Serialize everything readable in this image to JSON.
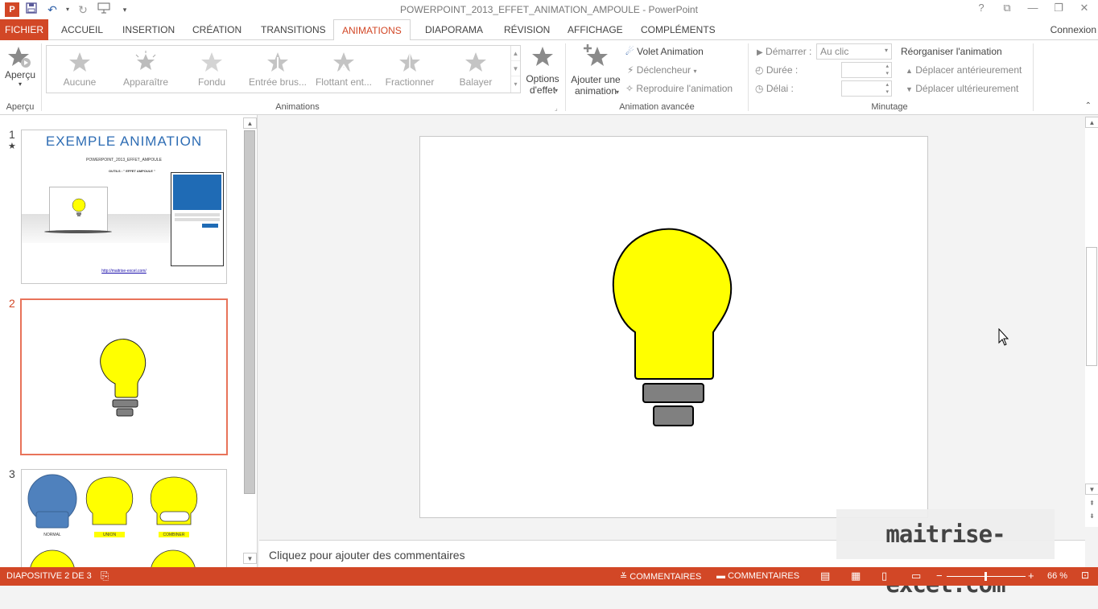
{
  "window": {
    "title": "POWERPOINT_2013_EFFET_ANIMATION_AMPOULE - PowerPoint",
    "app_icon_letter": "P",
    "controls": [
      "?",
      "⧉",
      "—",
      "❐",
      "✕"
    ]
  },
  "tabs": [
    {
      "label": "FICHIER"
    },
    {
      "label": "ACCUEIL"
    },
    {
      "label": "INSERTION"
    },
    {
      "label": "CRÉATION"
    },
    {
      "label": "TRANSITIONS"
    },
    {
      "label": "ANIMATIONS"
    },
    {
      "label": "DIAPORAMA"
    },
    {
      "label": "RÉVISION"
    },
    {
      "label": "AFFICHAGE"
    },
    {
      "label": "COMPLÉMENTS"
    }
  ],
  "connexion_label": "Connexion",
  "ribbon": {
    "preview": {
      "label": "Aperçu",
      "group_label": "Aperçu"
    },
    "gallery": {
      "items": [
        {
          "label": "Aucune"
        },
        {
          "label": "Apparaître"
        },
        {
          "label": "Fondu"
        },
        {
          "label": "Entrée brus..."
        },
        {
          "label": "Flottant ent..."
        },
        {
          "label": "Fractionner"
        },
        {
          "label": "Balayer"
        }
      ],
      "group_label": "Animations"
    },
    "effect_options": {
      "line1": "Options",
      "line2": "d'effet"
    },
    "advanced": {
      "add_line1": "Ajouter une",
      "add_line2": "animation",
      "volet": "Volet Animation",
      "declencheur": "Déclencheur",
      "reproduire": "Reproduire l'animation",
      "group_label": "Animation avancée"
    },
    "timing": {
      "start_label": "Démarrer :",
      "start_value": "Au clic",
      "duration_label": "Durée :",
      "delay_label": "Délai :",
      "reorder_title": "Réorganiser l'animation",
      "move_earlier": "Déplacer antérieurement",
      "move_later": "Déplacer ultérieurement",
      "group_label": "Minutage"
    }
  },
  "thumbnails": {
    "slide1": {
      "number": "1",
      "marker": "★",
      "title": "EXEMPLE ANIMATION",
      "subtitle": "POWERPOINT_2013_EFFET_AMPOULE",
      "tools": "OUTILS : \" EFFET AMPOULE \"",
      "link": "http://maitrise-excel.com/"
    },
    "slide2": {
      "number": "2"
    },
    "slide3": {
      "number": "3",
      "labels": [
        "NORMAL",
        "UNION",
        "COMBINER"
      ]
    }
  },
  "notes_placeholder": "Cliquez pour ajouter des commentaires",
  "watermark": "maitrise-excel.com",
  "status": {
    "slide_info": "DIAPOSITIVE 2 DE 3",
    "comments_notes": "COMMENTAIRES",
    "comments": "COMMENTAIRES",
    "zoom": "66 %",
    "zoom_fraction": 0.48
  },
  "colors": {
    "accent": "#d24726",
    "bulb": "#ffff00",
    "base": "#808080",
    "blue_bulb": "#4f81bd"
  }
}
